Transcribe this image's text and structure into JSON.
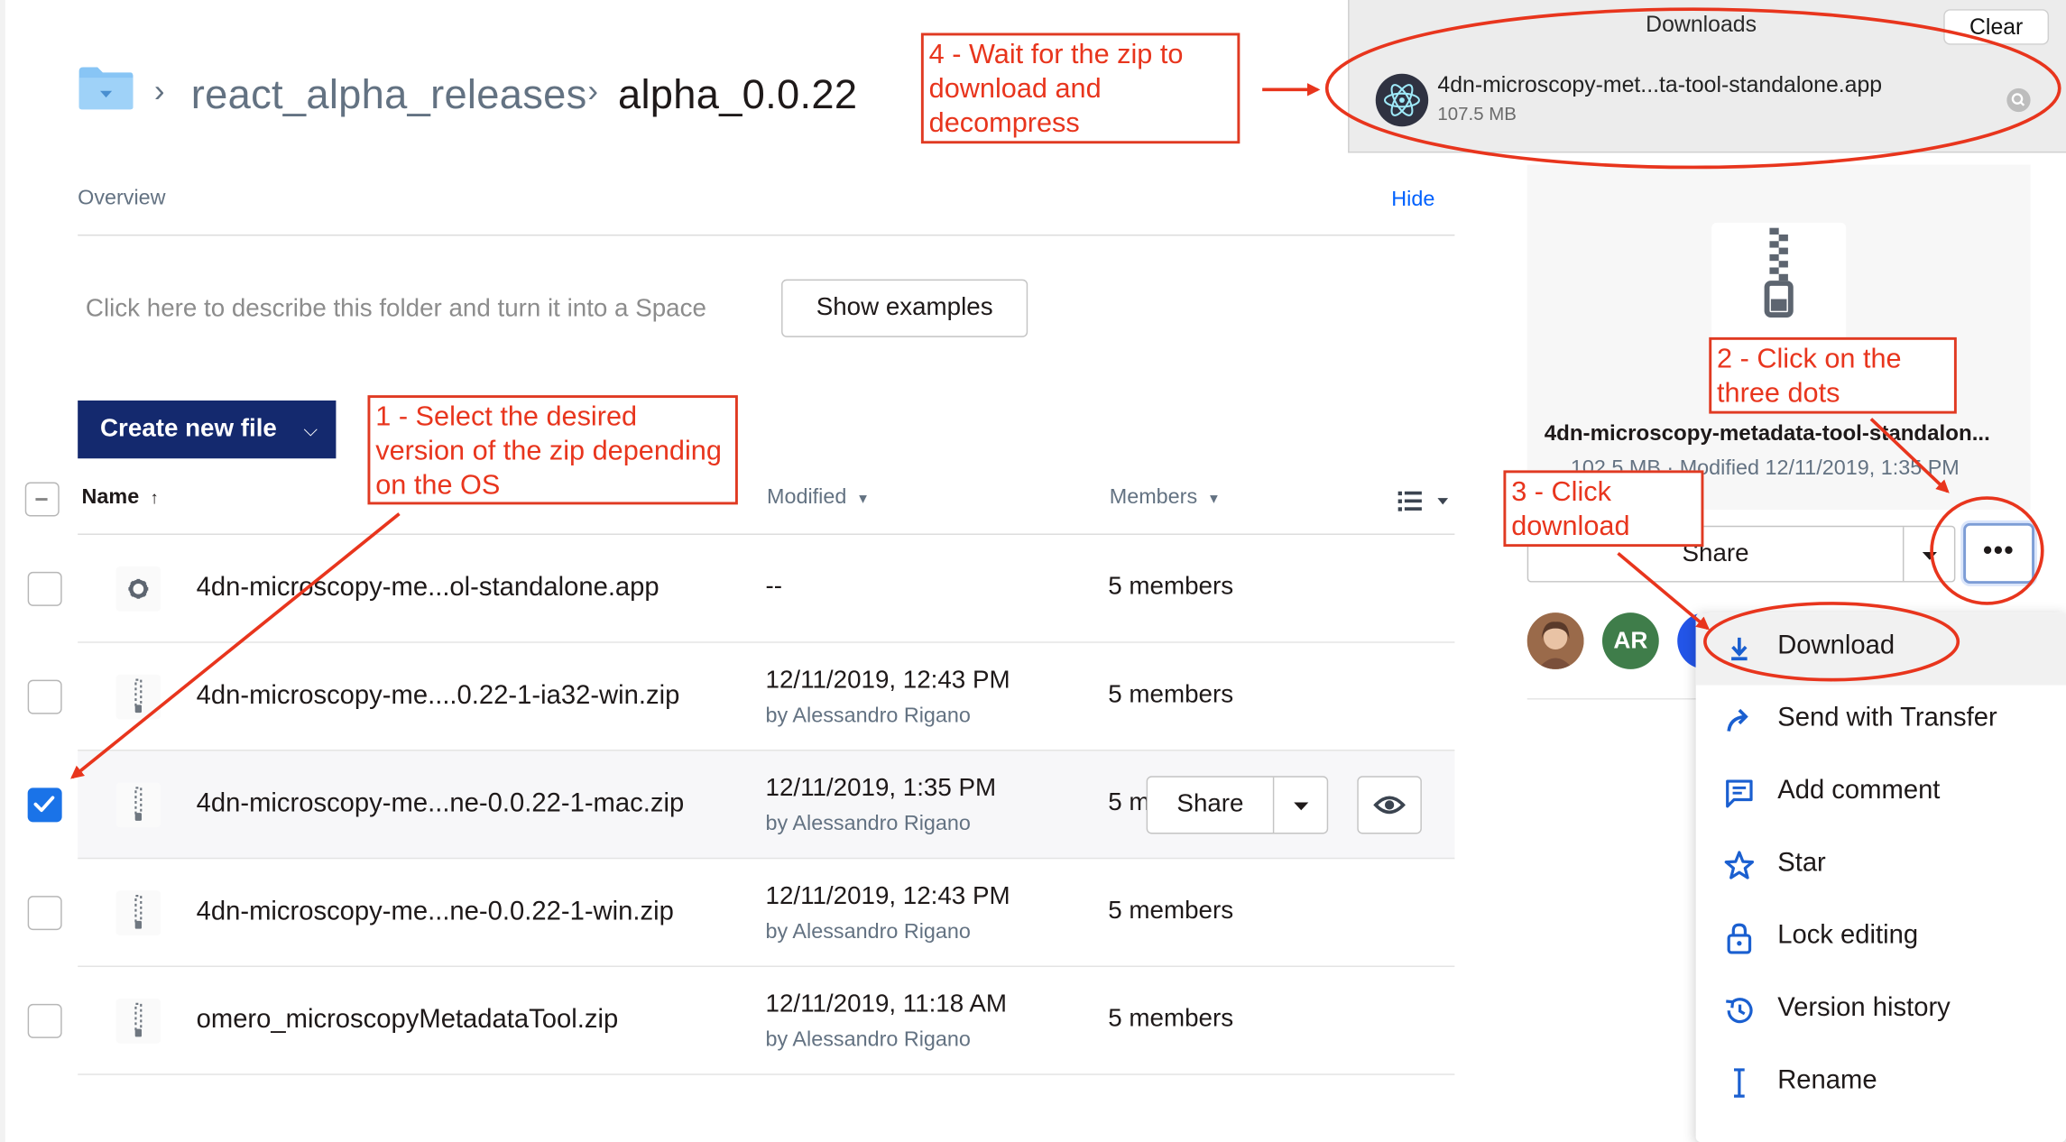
{
  "breadcrumb": {
    "parent": "react_alpha_releases",
    "current": "alpha_0.0.22",
    "separator": "›"
  },
  "overview": {
    "label": "Overview",
    "hide_link": "Hide",
    "describe_text": "Click here to describe this folder and turn it into a Space",
    "show_examples_label": "Show examples"
  },
  "toolbar": {
    "create_label": "Create new file",
    "create_caret": "⌵"
  },
  "table": {
    "headers": {
      "name": "Name",
      "name_sort": "↑",
      "modified": "Modified",
      "modified_caret": "▾",
      "members": "Members",
      "members_caret": "▾"
    },
    "rows": [
      {
        "name": "4dn-microscopy-me...ol-standalone.app",
        "modified": "--",
        "by": "",
        "members": "5 members",
        "checked": false,
        "icon": "gear-icon"
      },
      {
        "name": "4dn-microscopy-me....0.22-1-ia32-win.zip",
        "modified": "12/11/2019, 12:43 PM",
        "by": "by Alessandro Rigano",
        "members": "5 members",
        "checked": false,
        "icon": "zip-icon"
      },
      {
        "name": "4dn-microscopy-me...ne-0.0.22-1-mac.zip",
        "modified": "12/11/2019, 1:35 PM",
        "by": "by Alessandro Rigano",
        "members": "5 m",
        "checked": true,
        "icon": "zip-icon",
        "share_label": "Share"
      },
      {
        "name": "4dn-microscopy-me...ne-0.0.22-1-win.zip",
        "modified": "12/11/2019, 12:43 PM",
        "by": "by Alessandro Rigano",
        "members": "5 members",
        "checked": false,
        "icon": "zip-icon"
      },
      {
        "name": "omero_microscopyMetadataTool.zip",
        "modified": "12/11/2019, 11:18 AM",
        "by": "by Alessandro Rigano",
        "members": "5 members",
        "checked": false,
        "icon": "zip-icon"
      }
    ]
  },
  "downloads": {
    "title": "Downloads",
    "clear_label": "Clear",
    "item_name": "4dn-microscopy-met...ta-tool-standalone.app",
    "item_size": "107.5 MB"
  },
  "preview": {
    "file_name": "4dn-microscopy-metadata-tool-standalon...",
    "meta": "102.5 MB · Modified 12/11/2019, 1:35 PM",
    "share_label": "Share",
    "more_label": "•••",
    "avatar_initials": "AR"
  },
  "menu": {
    "items": [
      {
        "label": "Download",
        "icon": "download-icon"
      },
      {
        "label": "Send with Transfer",
        "icon": "transfer-icon"
      },
      {
        "label": "Add comment",
        "icon": "comment-icon"
      },
      {
        "label": "Star",
        "icon": "star-icon"
      },
      {
        "label": "Lock editing",
        "icon": "lock-icon"
      },
      {
        "label": "Version history",
        "icon": "history-icon"
      },
      {
        "label": "Rename",
        "icon": "rename-icon"
      }
    ]
  },
  "annotations": {
    "step1": "1 - Select the  desired version of the zip depending on the OS",
    "step2": "2 - Click on the three dots",
    "step3": "3 - Click download",
    "step4": "4 - Wait for the zip to download and decompress"
  },
  "colors": {
    "primary_button": "#14296e",
    "link": "#0061fe",
    "checkbox_checked": "#1a73e8",
    "annotation": "#e8351d",
    "folder": "#88c5f5"
  }
}
